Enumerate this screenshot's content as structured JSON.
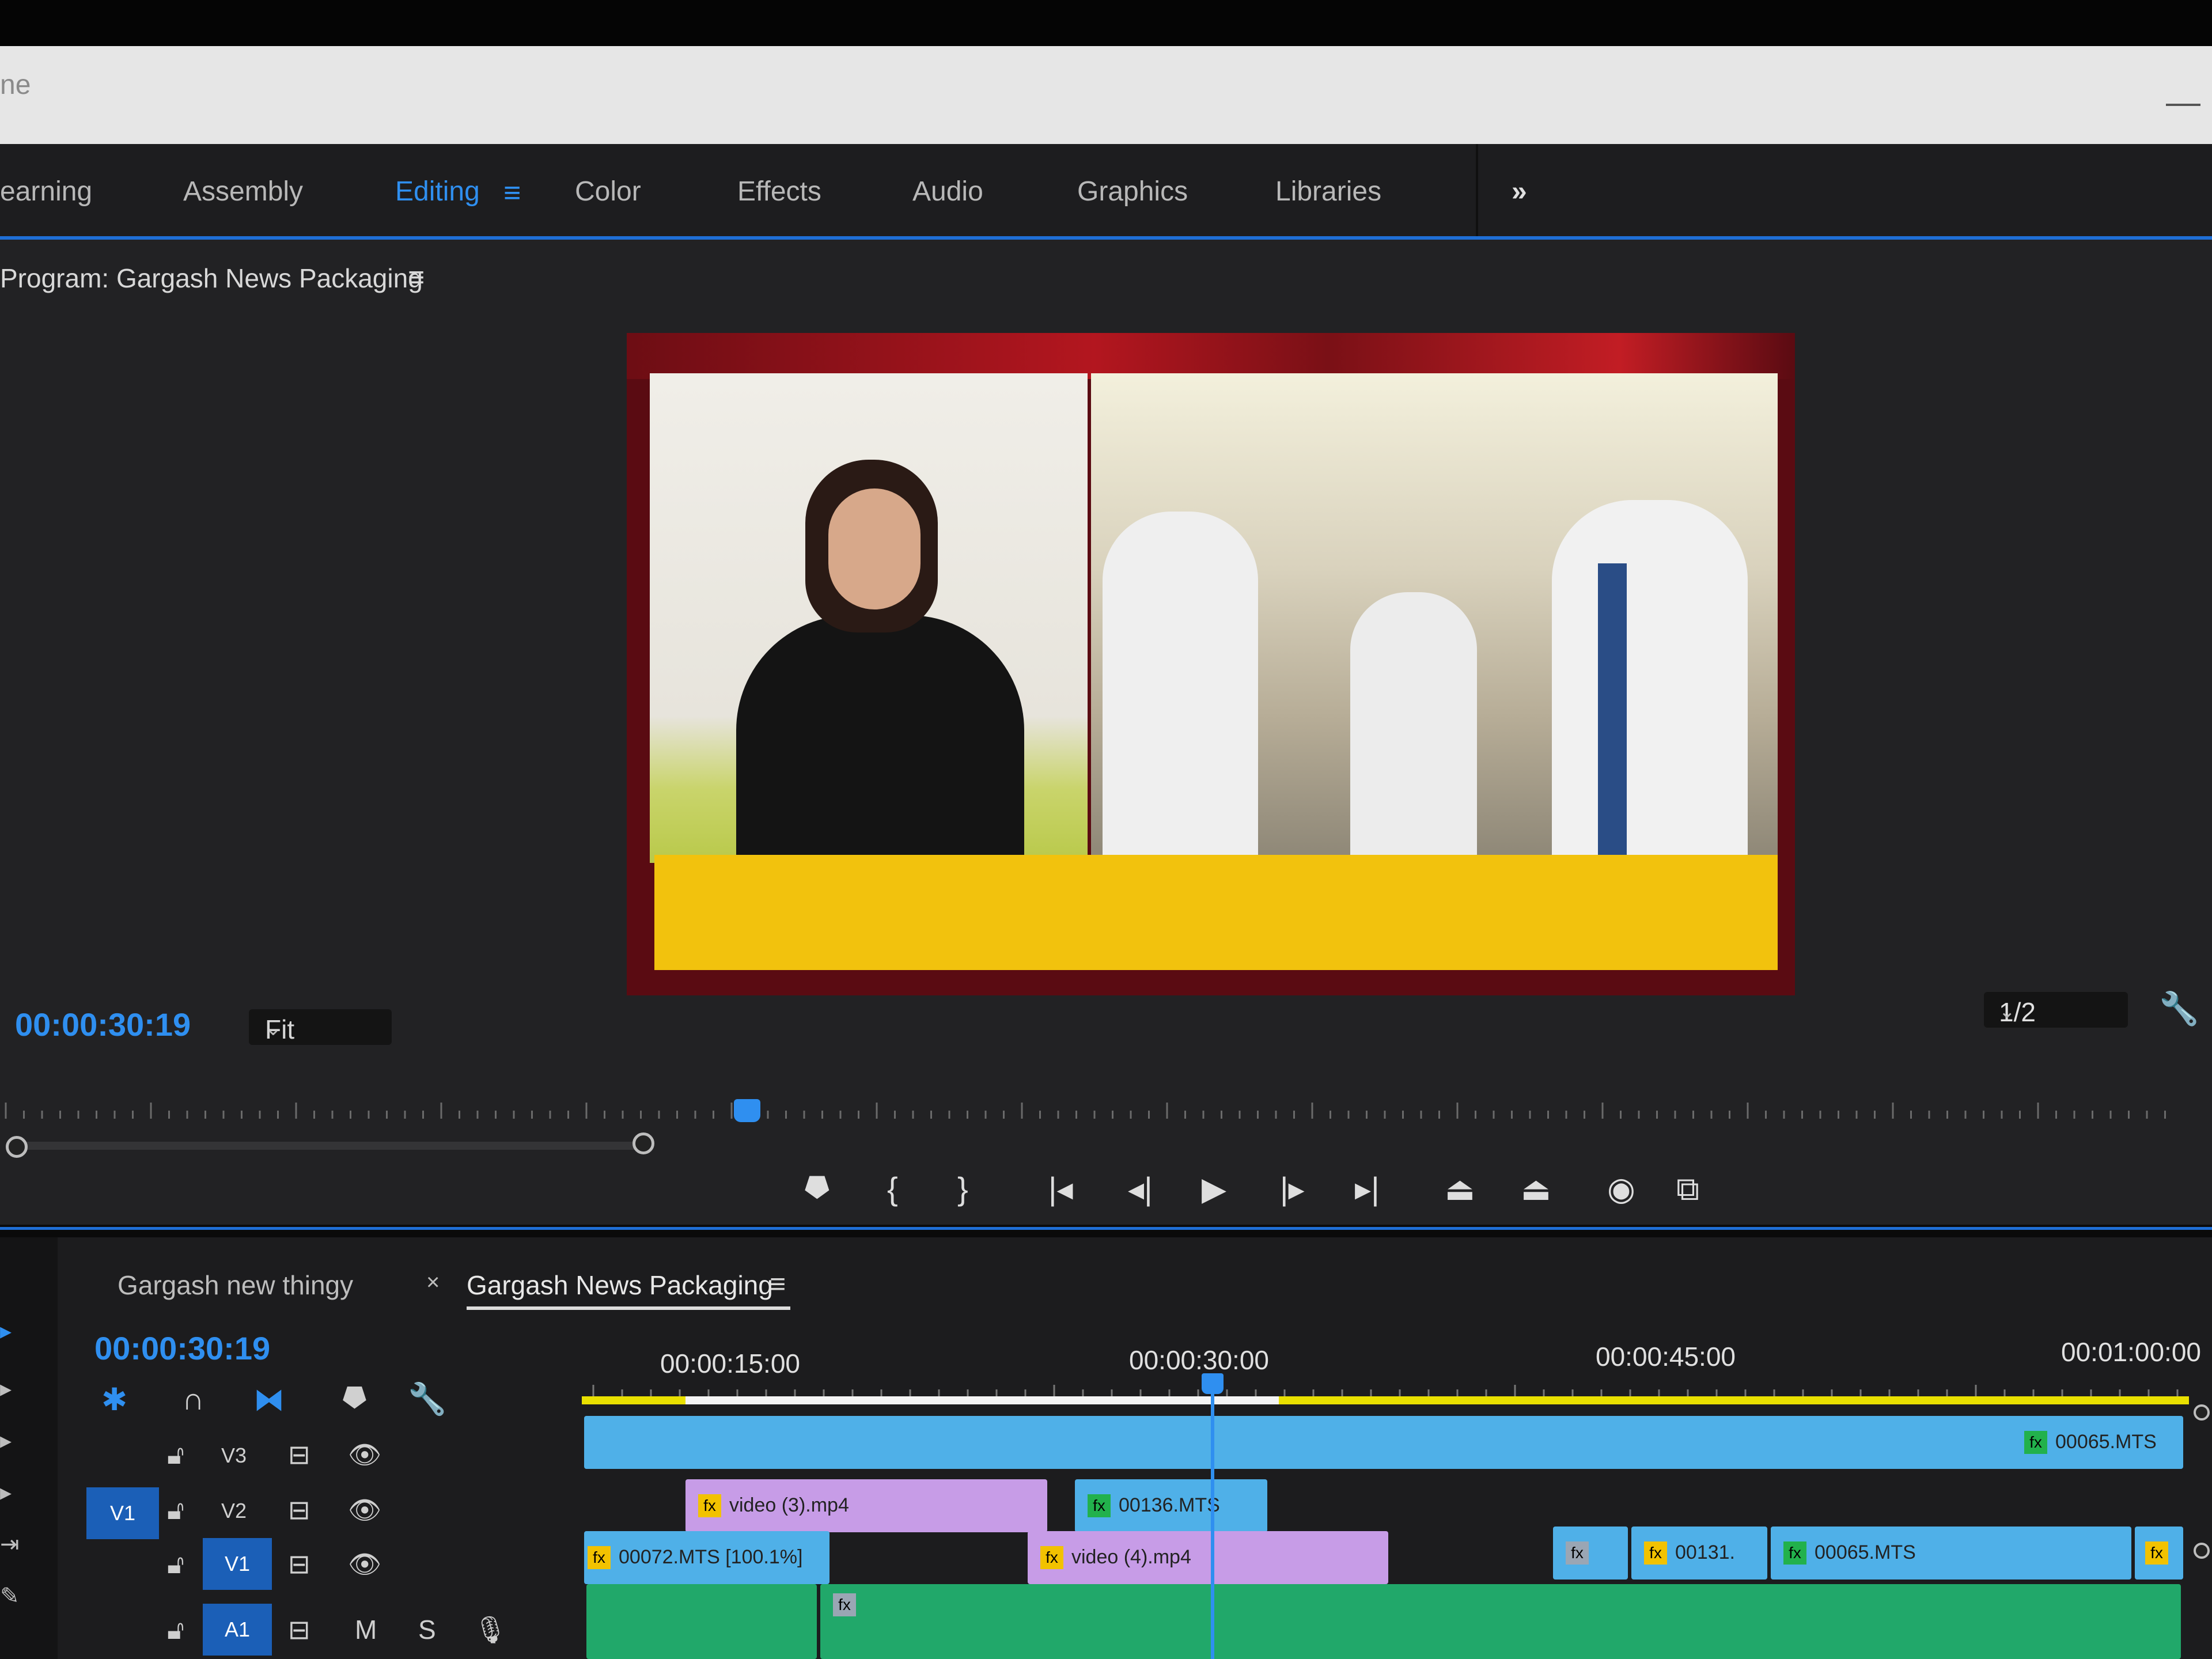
{
  "title_bar": {
    "text": "ne"
  },
  "workspaces": [
    {
      "label": "earning",
      "active": false
    },
    {
      "label": "Assembly",
      "active": false
    },
    {
      "label": "Editing",
      "active": true
    },
    {
      "label": "Color",
      "active": false
    },
    {
      "label": "Effects",
      "active": false
    },
    {
      "label": "Audio",
      "active": false
    },
    {
      "label": "Graphics",
      "active": false
    },
    {
      "label": "Libraries",
      "active": false
    }
  ],
  "workspace_menu_icon": "hamburger-icon",
  "workspace_overflow": "»",
  "program_monitor": {
    "title": "Program: Gargash News Packaging",
    "menu_icon": "≡",
    "timecode": "00:00:30:19",
    "zoom": "Fit",
    "resolution": "1/2",
    "settings_icon": "wrench-icon"
  },
  "transport": [
    {
      "name": "marker-icon",
      "glyph": "⯂"
    },
    {
      "name": "mark-in-icon",
      "glyph": "{"
    },
    {
      "name": "mark-out-icon",
      "glyph": "}"
    },
    {
      "name": "go-to-in-icon",
      "glyph": "|◂"
    },
    {
      "name": "step-back-icon",
      "glyph": "◂|"
    },
    {
      "name": "play-icon",
      "glyph": "▶"
    },
    {
      "name": "step-forward-icon",
      "glyph": "|▸"
    },
    {
      "name": "go-to-out-icon",
      "glyph": "▸|"
    },
    {
      "name": "lift-icon",
      "glyph": "⏏"
    },
    {
      "name": "extract-icon",
      "glyph": "⏏"
    },
    {
      "name": "export-frame-icon",
      "glyph": "◉"
    },
    {
      "name": "comparison-view-icon",
      "glyph": "⧉"
    }
  ],
  "timeline": {
    "tabs": [
      {
        "label": "Gargash new thingy",
        "active": false
      },
      {
        "label": "Gargash News Packaging",
        "active": true
      }
    ],
    "close_glyph": "×",
    "menu_icon": "≡",
    "timecode": "00:00:30:19",
    "ruler_labels": [
      "00:00:15:00",
      "00:00:30:00",
      "00:00:45:00",
      "00:01:00:00"
    ],
    "tools": [
      {
        "name": "nest-icon",
        "glyph": "✱",
        "color": "#2f8ff0"
      },
      {
        "name": "snap-icon",
        "glyph": "∩",
        "color": "#d0d0d0"
      },
      {
        "name": "linked-selection-icon",
        "glyph": "⧓",
        "color": "#2f8ff0"
      },
      {
        "name": "add-marker-icon",
        "glyph": "⯂",
        "color": "#d0d0d0"
      },
      {
        "name": "timeline-settings-icon",
        "glyph": "🔧",
        "color": "#d0d0d0"
      }
    ],
    "tracks": [
      {
        "name": "V3",
        "selected": false
      },
      {
        "name": "V2",
        "selected": false
      },
      {
        "name": "V1",
        "selected": true
      },
      {
        "name": "A1",
        "selected": true
      }
    ],
    "source_patch": "V1",
    "audio_buttons": {
      "mute": "M",
      "solo": "S"
    },
    "clips": [
      {
        "label": "00065.MTS",
        "fx": "fx",
        "fx_color": "green"
      },
      {
        "label": "video (3).mp4",
        "fx": "fx",
        "fx_color": "yellow"
      },
      {
        "label": "00136.MTS",
        "fx": "fx",
        "fx_color": "green"
      },
      {
        "label": "00072.MTS [100.1%]",
        "fx": "fx",
        "fx_color": "yellow"
      },
      {
        "label": "video (4).mp4",
        "fx": "fx",
        "fx_color": "yellow"
      },
      {
        "label": "",
        "fx": "fx",
        "fx_color": "gray"
      },
      {
        "label": "00131.",
        "fx": "fx",
        "fx_color": "yellow"
      },
      {
        "label": "00065.MTS",
        "fx": "fx",
        "fx_color": "green"
      },
      {
        "label": "",
        "fx": "fx",
        "fx_color": "yellow"
      },
      {
        "label": "",
        "fx": "fx",
        "fx_color": "gray"
      }
    ]
  },
  "colors": {
    "accent": "#2f8ff0",
    "clip_blue": "#4fb0e8",
    "clip_violet": "#c79ce7",
    "clip_green": "#21a86a",
    "work_area": "#e9e000"
  }
}
